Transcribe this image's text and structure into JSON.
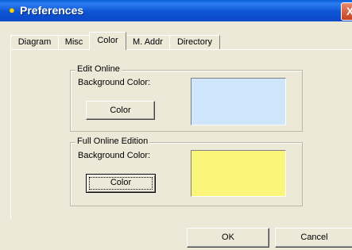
{
  "window": {
    "title": "Preferences",
    "close_glyph": "X"
  },
  "tabs": [
    {
      "label": "Diagram",
      "active": false
    },
    {
      "label": "Misc",
      "active": false
    },
    {
      "label": "Color",
      "active": true
    },
    {
      "label": "M. Addr",
      "active": false
    },
    {
      "label": "Directory",
      "active": false
    }
  ],
  "edit_online": {
    "title": "Edit Online",
    "bg_label": "Background Color:",
    "button_label": "Color",
    "swatch_color": "#cfe5fb"
  },
  "full_online": {
    "title": "Full Online Edition",
    "bg_label": "Background Color:",
    "button_label": "Color",
    "swatch_color": "#fbf67a"
  },
  "buttons": {
    "ok": "OK",
    "cancel": "Cancel"
  }
}
